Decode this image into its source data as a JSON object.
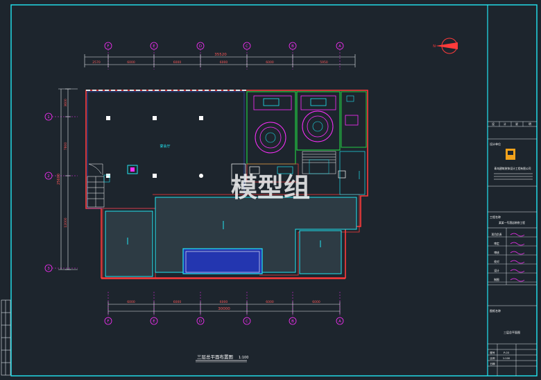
{
  "plan": {
    "title": "三层总平面布置图",
    "scale": "1:100",
    "watermark": "模型组",
    "axes_top": [
      "F",
      "E",
      "D",
      "C",
      "B",
      "A"
    ],
    "axes_bottom": [
      "F",
      "E",
      "D",
      "C",
      "B",
      "A"
    ],
    "axes_left": [
      "1",
      "2",
      "3"
    ],
    "dims_top_total": "35520",
    "dims_top_segments": [
      "2570",
      "6000",
      "6000",
      "6000",
      "6000",
      "5950"
    ],
    "dims_bottom_total": "30000",
    "dims_bottom_segments": [
      "6000",
      "6000",
      "6000",
      "6000",
      "6000"
    ],
    "dims_left_total": "25600",
    "dims_left_segments": [
      "3600",
      "7800",
      "12000"
    ],
    "room_label": "宴会厅",
    "north_label": "N"
  },
  "title_block": {
    "header_cells": [
      "设",
      "计",
      "说",
      "明"
    ],
    "design_unit_label": "设计单位",
    "company_name": "青岛建筑装饰设计工程有限公司",
    "project_label": "工程名称",
    "project_name": "某某一号酒店装修工程",
    "sign_rows": [
      "项目负责",
      "审定",
      "审核",
      "校对",
      "设计",
      "制图"
    ],
    "drawing_label": "图纸名称",
    "drawing_name": "三层总平面图",
    "footer_rows": [
      {
        "label": "图号",
        "value": "P-03"
      },
      {
        "label": "比例",
        "value": "1:100"
      },
      {
        "label": "日期",
        "value": ""
      }
    ]
  }
}
